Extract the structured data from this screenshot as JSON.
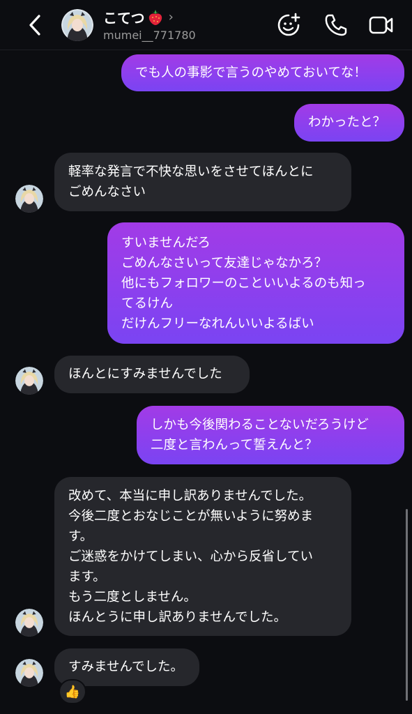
{
  "header": {
    "contact_name": "こてつ",
    "name_emoji": "strawberry",
    "chevron": "›",
    "username": "mumei__771780",
    "icons": [
      "back-icon",
      "sticker-add-icon",
      "phone-icon",
      "video-call-icon"
    ]
  },
  "messages": [
    {
      "side": "outgoing",
      "lines": [
        "でも人の事影で言うのやめておいてな！"
      ]
    },
    {
      "side": "outgoing",
      "lines": [
        "わかったと？"
      ]
    },
    {
      "side": "incoming",
      "lines": [
        "軽率な発言で不快な思いをさせてほんとに",
        "ごめんなさい"
      ]
    },
    {
      "side": "outgoing",
      "lines": [
        "すいませんだろ",
        "ごめんなさいって友達じゃなかろ？",
        "他にもフォロワーのこといいよるのも知っ",
        "てるけん",
        "だけんフリーなれんいいよるばい"
      ]
    },
    {
      "side": "incoming",
      "lines": [
        "ほんとにすみませんでした"
      ]
    },
    {
      "side": "outgoing",
      "lines": [
        "しかも今後関わることないだろうけど",
        "二度と言わんって誓えんと？"
      ]
    },
    {
      "side": "incoming",
      "lines": [
        "改めて、本当に申し訳ありませんでした。",
        "今後二度とおなじことが無いように努めま",
        "す。",
        "ご迷惑をかけてしまい、心から反省してい",
        "ます。",
        "もう二度としません。",
        "ほんとうに申し訳ありませんでした。"
      ]
    },
    {
      "side": "incoming",
      "lines": [
        "すみませんでした。"
      ]
    }
  ],
  "reaction": {
    "emoji": "👍"
  },
  "colors": {
    "background": "#0c0d11",
    "incoming_bubble": "#26272c",
    "outgoing_gradient_top": "#a23be6",
    "outgoing_gradient_bottom": "#7a44f2"
  }
}
